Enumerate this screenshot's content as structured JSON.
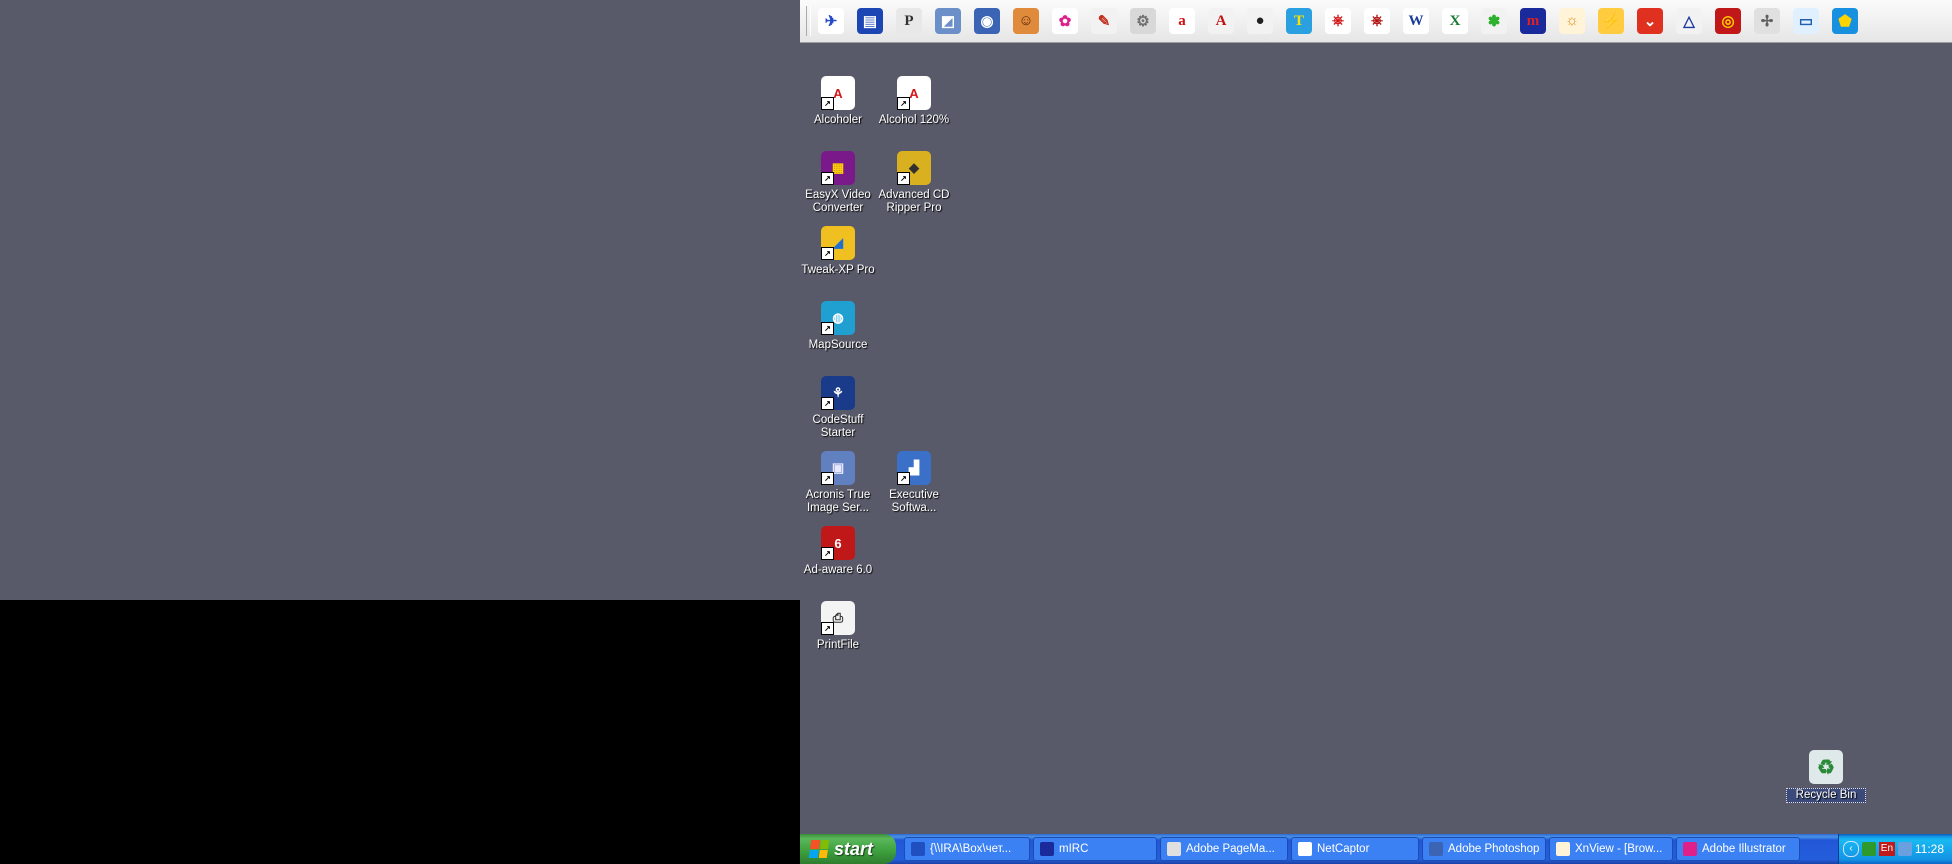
{
  "quicklaunch": [
    {
      "name": "netcaptor-icon",
      "glyph": "✈",
      "bg": "#ffffff",
      "fg": "#2448c8"
    },
    {
      "name": "film-icon",
      "glyph": "▤",
      "bg": "#1c46b4",
      "fg": "#ffffff"
    },
    {
      "name": "pagemaker-icon",
      "glyph": "P",
      "bg": "#e8e8e8",
      "fg": "#333333"
    },
    {
      "name": "image-editor-icon",
      "glyph": "◩",
      "bg": "#6b8fc8",
      "fg": "#ffffff"
    },
    {
      "name": "photoshop-icon",
      "glyph": "◉",
      "bg": "#3c64b4",
      "fg": "#ffffff"
    },
    {
      "name": "portrait-icon",
      "glyph": "☺",
      "bg": "#e08a3c",
      "fg": "#5a2a10"
    },
    {
      "name": "flower-icon",
      "glyph": "✿",
      "bg": "#ffffff",
      "fg": "#e0208a"
    },
    {
      "name": "brush-icon",
      "glyph": "✎",
      "bg": "#f2f2f2",
      "fg": "#c0301c"
    },
    {
      "name": "grey-tool-icon",
      "glyph": "⚙",
      "bg": "#d8d8d8",
      "fg": "#707070"
    },
    {
      "name": "adobe-a-icon",
      "glyph": "a",
      "bg": "#ffffff",
      "fg": "#d01010"
    },
    {
      "name": "acrobat-icon",
      "glyph": "A",
      "bg": "#f2f2f2",
      "fg": "#c01010"
    },
    {
      "name": "bubbles-icon",
      "glyph": "●",
      "bg": "#f2f2f2",
      "fg": "#202020"
    },
    {
      "name": "typography-icon",
      "glyph": "T",
      "bg": "#2aa0e0",
      "fg": "#ffe000"
    },
    {
      "name": "pdf-icon",
      "glyph": "⎈",
      "bg": "#ffffff",
      "fg": "#d01818"
    },
    {
      "name": "pdf-writer-icon",
      "glyph": "⎈",
      "bg": "#ffffff",
      "fg": "#b01010"
    },
    {
      "name": "word-icon",
      "glyph": "W",
      "bg": "#ffffff",
      "fg": "#1c3c9c"
    },
    {
      "name": "excel-icon",
      "glyph": "X",
      "bg": "#ffffff",
      "fg": "#1a7a34"
    },
    {
      "name": "icq-icon",
      "glyph": "✽",
      "bg": "#f2f2f2",
      "fg": "#2cb02c"
    },
    {
      "name": "mirc-icon",
      "glyph": "m",
      "bg": "#1a2a9a",
      "fg": "#e02020"
    },
    {
      "name": "xnview-icon",
      "glyph": "☼",
      "bg": "#fff3d8",
      "fg": "#e08a10"
    },
    {
      "name": "lightning-icon",
      "glyph": "⚡",
      "bg": "#ffcc40",
      "fg": "#303030"
    },
    {
      "name": "shield-icon",
      "glyph": "⌄",
      "bg": "#e03020",
      "fg": "#ffffff"
    },
    {
      "name": "triangle-icon",
      "glyph": "△",
      "bg": "#f2f2f2",
      "fg": "#1a3aa0"
    },
    {
      "name": "burn-disc-icon",
      "glyph": "◎",
      "bg": "#c01818",
      "fg": "#ffcc00"
    },
    {
      "name": "fan-icon",
      "glyph": "✢",
      "bg": "#e0e0e0",
      "fg": "#606060"
    },
    {
      "name": "scanner-icon",
      "glyph": "▭",
      "bg": "#e0f0ff",
      "fg": "#2060b0"
    },
    {
      "name": "gem-icon",
      "glyph": "⬟",
      "bg": "#1890e0",
      "fg": "#ffd400"
    }
  ],
  "desktop_icons": [
    {
      "label": "Alcoholer",
      "name": "alcoholer-icon",
      "glyph": "A",
      "bg": "#ffffff",
      "fg": "#d01818"
    },
    {
      "label": "Alcohol 120%",
      "name": "alcohol-120-icon",
      "glyph": "A",
      "bg": "#ffffff",
      "fg": "#d01818"
    },
    {
      "label": "EasyX Video Converter",
      "name": "easyx-video-converter-icon",
      "glyph": "▦",
      "bg": "#7a1a8a",
      "fg": "#ffd000"
    },
    {
      "label": "Advanced CD Ripper Pro",
      "name": "advanced-cd-ripper-icon",
      "glyph": "◆",
      "bg": "#d8b020",
      "fg": "#303030"
    },
    {
      "label": "Tweak-XP Pro",
      "name": "tweak-xp-pro-icon",
      "glyph": "◢",
      "bg": "#f0c020",
      "fg": "#2070d0"
    },
    {
      "label": "MapSource",
      "name": "mapsource-icon",
      "glyph": "◍",
      "bg": "#20a0d0",
      "fg": "#ffffff"
    },
    {
      "label": "CodeStuff Starter",
      "name": "codestuff-starter-icon",
      "glyph": "⚘",
      "bg": "#1a3a8a",
      "fg": "#ffffff"
    },
    {
      "label": "Acronis True Image Ser...",
      "name": "acronis-true-image-icon",
      "glyph": "▣",
      "bg": "#6080c0",
      "fg": "#e8e8ff"
    },
    {
      "label": "Executive Softwa...",
      "name": "executive-software-icon",
      "glyph": "▟",
      "bg": "#3a70c8",
      "fg": "#ffffff"
    },
    {
      "label": "Ad-aware 6.0",
      "name": "ad-aware-icon",
      "glyph": "6",
      "bg": "#c01818",
      "fg": "#ffffff"
    },
    {
      "label": "PrintFile",
      "name": "printfile-icon",
      "glyph": "⎙",
      "bg": "#f4f4f4",
      "fg": "#303030"
    }
  ],
  "recycle_bin": {
    "label": "Recycle Bin",
    "glyph": "♻"
  },
  "taskbar": {
    "start_label": "start",
    "tasks": [
      {
        "label": "{\\\\IRA\\Box\\чет...",
        "name": "task-box-folder",
        "color": "#2050c0"
      },
      {
        "label": "mIRC",
        "name": "task-mirc",
        "color": "#1a2a9a"
      },
      {
        "label": "Adobe PageMa...",
        "name": "task-pagemaker",
        "color": "#e0e0e0"
      },
      {
        "label": "NetCaptor",
        "name": "task-netcaptor",
        "color": "#ffffff"
      },
      {
        "label": "Adobe Photoshop",
        "name": "task-photoshop",
        "color": "#3c64b4"
      },
      {
        "label": "XnView - [Brow...",
        "name": "task-xnview",
        "color": "#fff3d8"
      },
      {
        "label": "Adobe Illustrator",
        "name": "task-illustrator",
        "color": "#e0208a"
      }
    ],
    "tray": {
      "lang": "En",
      "clock": "11:28"
    }
  }
}
